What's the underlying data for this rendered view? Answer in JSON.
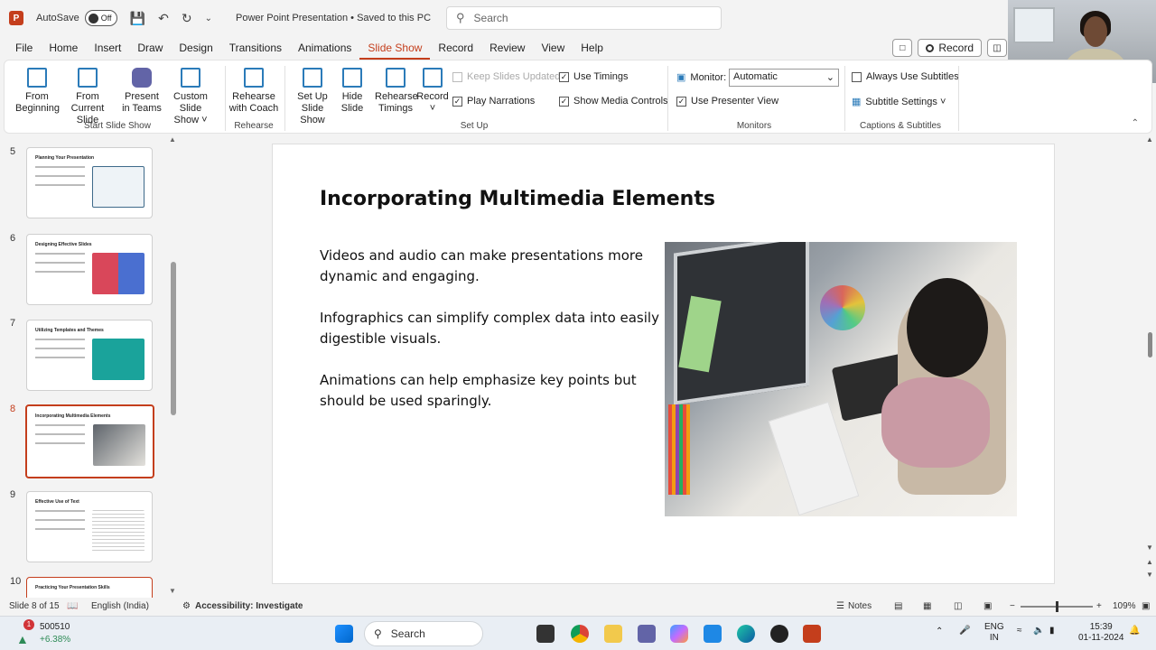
{
  "titlebar": {
    "autosave_label": "AutoSave",
    "autosave_state": "Off",
    "document_title": "Power Point Presentation • Saved to this PC",
    "search_placeholder": "Search"
  },
  "menu": {
    "items": [
      "File",
      "Home",
      "Insert",
      "Draw",
      "Design",
      "Transitions",
      "Animations",
      "Slide Show",
      "Record",
      "Review",
      "View",
      "Help"
    ],
    "active": "Slide Show",
    "record_label": "Record"
  },
  "ribbon": {
    "from_beginning": [
      "From",
      "Beginning"
    ],
    "from_current": [
      "From",
      "Current Slide"
    ],
    "present_teams": [
      "Present",
      "in Teams"
    ],
    "custom_show": [
      "Custom Slide",
      "Show ˅"
    ],
    "rehearse_coach": [
      "Rehearse",
      "with Coach"
    ],
    "setup_show": [
      "Set Up",
      "Slide Show"
    ],
    "hide_slide": [
      "Hide",
      "Slide"
    ],
    "rehearse_timings": [
      "Rehearse",
      "Timings"
    ],
    "record": [
      "Record",
      "˅"
    ],
    "keep_updated": "Keep Slides Updated",
    "use_timings": "Use Timings",
    "play_narrations": "Play Narrations",
    "show_media": "Show Media Controls",
    "monitor_label": "Monitor:",
    "monitor_value": "Automatic",
    "presenter_view": "Use Presenter View",
    "always_subtitles": "Always Use Subtitles",
    "subtitle_settings": "Subtitle Settings ˅",
    "groups": {
      "start": "Start Slide Show",
      "rehearse": "Rehearse",
      "setup": "Set Up",
      "monitors": "Monitors",
      "captions": "Captions & Subtitles"
    }
  },
  "thumbnails": [
    {
      "num": "5",
      "title": "Planning Your Presentation",
      "art": "#3e6a8a"
    },
    {
      "num": "6",
      "title": "Designing Effective Slides",
      "art": "#d9475a"
    },
    {
      "num": "7",
      "title": "Utilizing Templates and Themes",
      "art": "#1aa39b"
    },
    {
      "num": "8",
      "title": "Incorporating Multimedia Elements",
      "art": "#8e969d"
    },
    {
      "num": "9",
      "title": "Effective Use of Text",
      "art": "#dcdcdc"
    },
    {
      "num": "10",
      "title": "Practicing Your Presentation Skills",
      "art": "#333333"
    }
  ],
  "slide": {
    "title": "Incorporating Multimedia Elements",
    "bullets": [
      "Videos and audio can make presentations more dynamic and engaging.",
      "Infographics can simplify complex data into easily digestible visuals.",
      "Animations can help emphasize key points but should be used sparingly."
    ]
  },
  "status": {
    "slide_count": "Slide 8 of 15",
    "language": "English (India)",
    "accessibility": "Accessibility: Investigate",
    "notes": "Notes",
    "zoom": "109%"
  },
  "taskbar": {
    "stock_name": "500510",
    "stock_change": "+6.38%",
    "search": "Search",
    "lang_top": "ENG",
    "lang_bottom": "IN",
    "time": "15:39",
    "date": "01-11-2024"
  },
  "colors": {
    "accent": "#c43e1c",
    "ribbon_icon": "#2b7bb9"
  }
}
